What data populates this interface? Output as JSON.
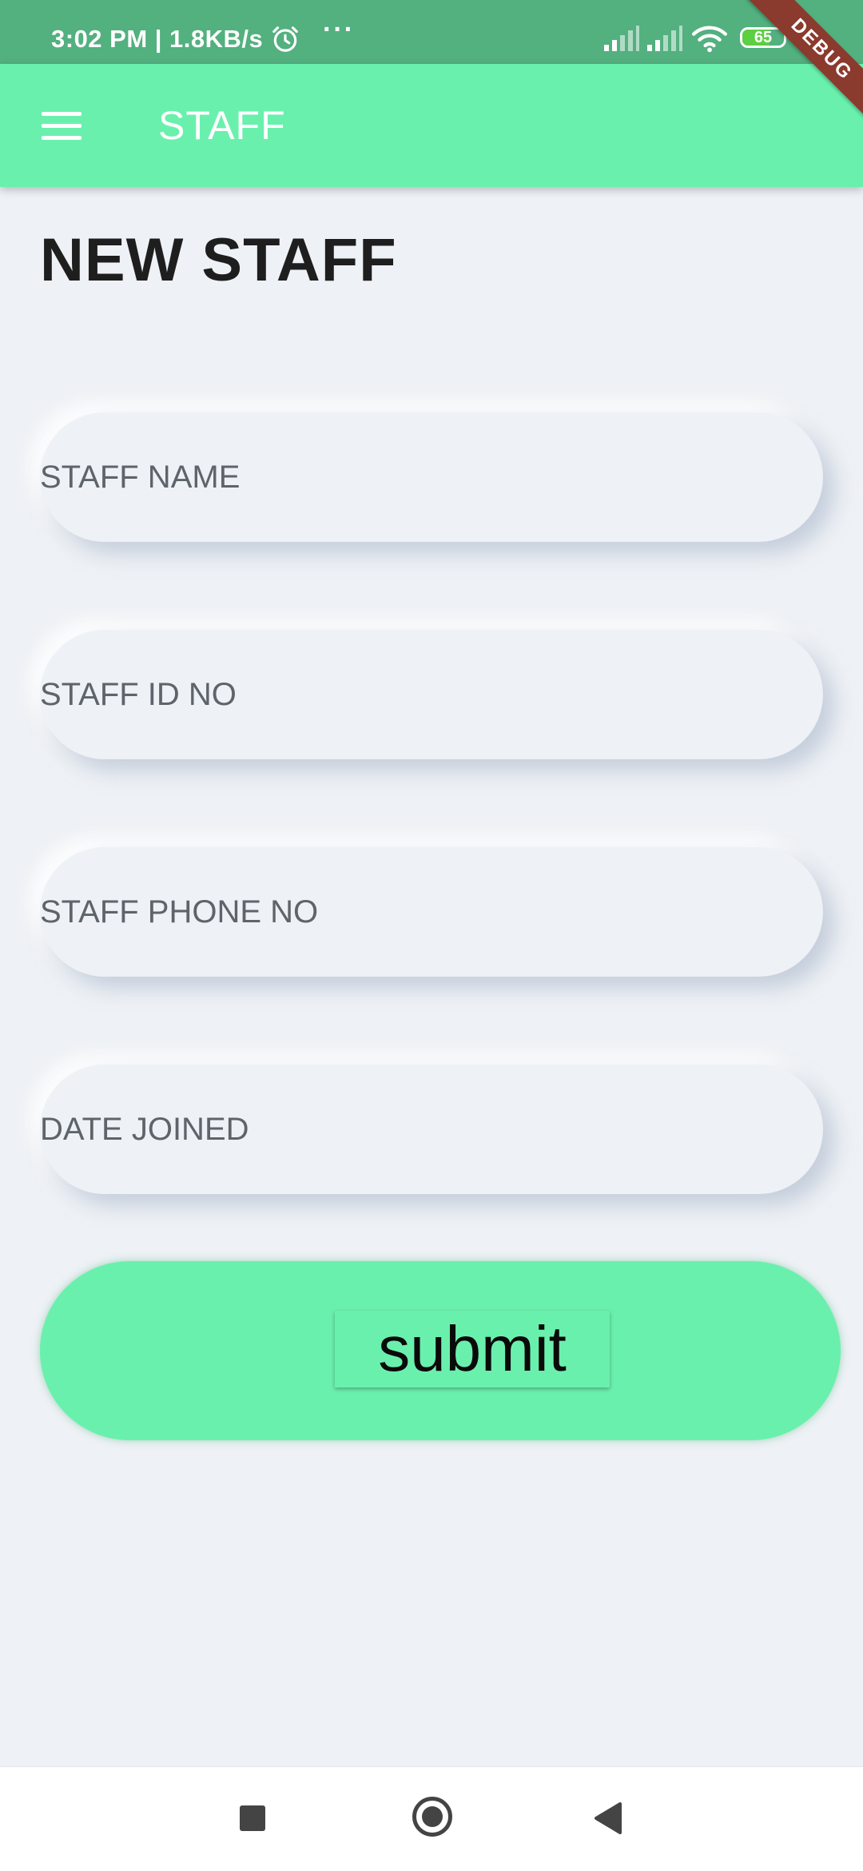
{
  "status_bar": {
    "time_and_speed": "3:02 PM | 1.8KB/s",
    "more_indicator": "···",
    "battery_level": "65",
    "battery_fraction": 0.65,
    "icons": [
      "alarm-icon",
      "signal-icon",
      "signal-icon",
      "wifi-icon",
      "battery-icon",
      "charging-icon"
    ]
  },
  "debug_banner": "DEBUG",
  "app_bar": {
    "title": "STAFF",
    "menu_icon": "hamburger-menu-icon"
  },
  "form": {
    "heading": "NEW STAFF",
    "fields": [
      {
        "placeholder": "STAFF NAME",
        "value": ""
      },
      {
        "placeholder": "STAFF ID NO",
        "value": ""
      },
      {
        "placeholder": "STAFF PHONE NO",
        "value": ""
      },
      {
        "placeholder": "DATE JOINED",
        "value": ""
      }
    ],
    "submit_label": "submit"
  },
  "nav_bar": {
    "icons": [
      "recent-apps-icon",
      "home-icon",
      "back-icon"
    ]
  },
  "colors": {
    "status_bar": "#53b07f",
    "accent": "#6af0ad",
    "background": "#eef1f5",
    "heading_text": "#1e1e1e",
    "placeholder_text": "#5e646b",
    "debug_banner": "#8b3a2e"
  }
}
